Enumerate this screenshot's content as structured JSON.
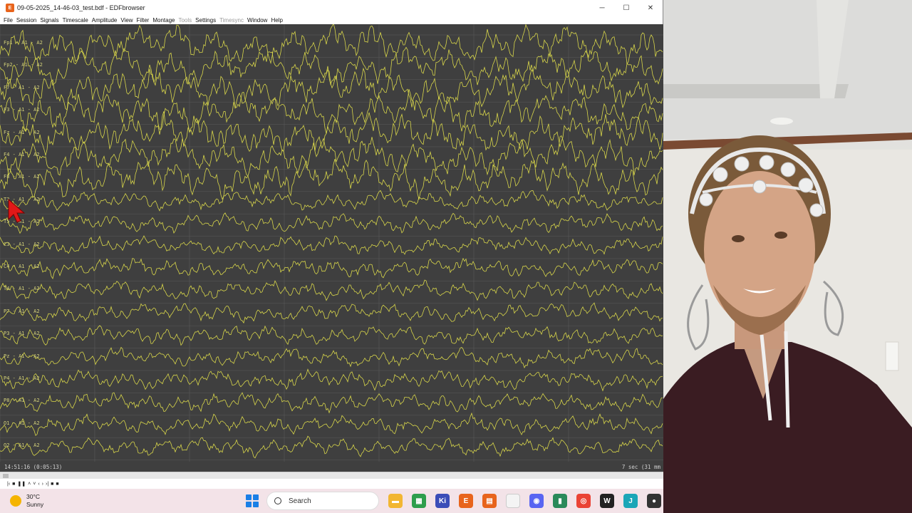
{
  "window": {
    "title": "09-05-2025_14-46-03_test.bdf - EDFbrowser",
    "minimize": "─",
    "maximize": "☐",
    "close": "✕"
  },
  "menu": [
    {
      "label": "File",
      "enabled": true
    },
    {
      "label": "Session",
      "enabled": true
    },
    {
      "label": "Signals",
      "enabled": true
    },
    {
      "label": "Timescale",
      "enabled": true
    },
    {
      "label": "Amplitude",
      "enabled": true
    },
    {
      "label": "View",
      "enabled": true
    },
    {
      "label": "Filter",
      "enabled": true
    },
    {
      "label": "Montage",
      "enabled": true
    },
    {
      "label": "Tools",
      "enabled": false
    },
    {
      "label": "Settings",
      "enabled": true
    },
    {
      "label": "Timesync",
      "enabled": false
    },
    {
      "label": "Window",
      "enabled": true
    },
    {
      "label": "Help",
      "enabled": true
    }
  ],
  "channels": [
    "Fp1 - A1 - A2",
    "Fp2 - A1 - A2",
    "F7 - A1 - A2",
    "F3 - A1 - A2",
    "Fz - A1 - A2",
    "F4 - A1 - A2",
    "F8 - A1 - A2",
    "T3 - A1 - A2",
    "T5 - A1 - A2",
    "C3 - A1 - A2",
    "C4 - A1 - A2",
    "T4 - A1 - A2",
    "P7 - A1 - A2",
    "P3 - A1 - A2",
    "Pz - A1 - A2",
    "P4 - A1 - A2",
    "P8 - A1 - A2",
    "O1 - A1 - A2",
    "O2 - A1 - A2"
  ],
  "status": {
    "time": "14:51:16 (0:05:13)",
    "timescale": "7 sec (31 mm"
  },
  "playback": [
    "|‹",
    "■",
    "❚❚",
    "˄",
    "˅",
    "‹",
    "›",
    "›|",
    "■",
    "■"
  ],
  "colors": {
    "trace": "#d8d64a",
    "background": "#3f3f3f",
    "grid": "#5a5a5a"
  },
  "taskbar": {
    "weather_temp": "30°C",
    "weather_desc": "Sunny",
    "search_label": "Search",
    "apps": [
      "file-explorer-icon",
      "sheets-icon",
      "kicad-icon",
      "office-icon",
      "edfbrowser-icon",
      "notepad-icon",
      "discord-icon",
      "chart-app-icon",
      "chrome-icon",
      "wave-app-icon",
      "editor-icon",
      "tray-app-icon"
    ]
  }
}
